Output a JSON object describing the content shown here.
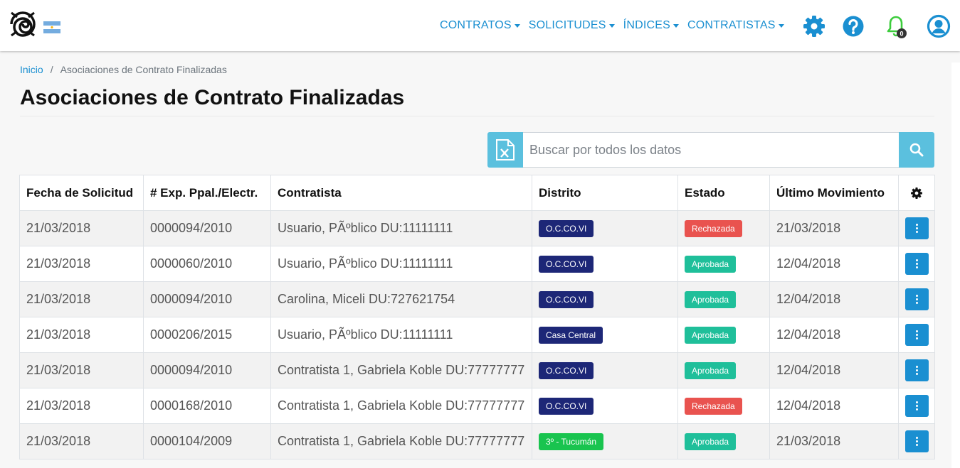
{
  "nav": {
    "items": [
      {
        "label": "CONTRATOS"
      },
      {
        "label": "SOLICITUDES"
      },
      {
        "label": "ÍNDICES"
      },
      {
        "label": "CONTRATISTAS"
      }
    ],
    "notification_count": "0"
  },
  "breadcrumb": {
    "home": "Inicio",
    "separator": "/",
    "current": "Asociaciones de Contrato Finalizadas"
  },
  "page": {
    "title": "Asociaciones de Contrato Finalizadas"
  },
  "search": {
    "placeholder": "Buscar por todos los datos",
    "value": ""
  },
  "table": {
    "headers": [
      "Fecha de Solicitud",
      "# Exp. Ppal./Electr.",
      "Contratista",
      "Distrito",
      "Estado",
      "Último Movimiento"
    ],
    "rows": [
      {
        "fecha": "21/03/2018",
        "exp": "0000094/2010",
        "contratista": "Usuario, PÃºblico DU:11111111",
        "distrito": "O.C.CO.VI",
        "distrito_color": "#1d2777",
        "estado": "Rechazada",
        "estado_color": "#e9534f",
        "ultimo": "21/03/2018"
      },
      {
        "fecha": "21/03/2018",
        "exp": "0000060/2010",
        "contratista": "Usuario, PÃºblico DU:11111111",
        "distrito": "O.C.CO.VI",
        "distrito_color": "#1d2777",
        "estado": "Aprobada",
        "estado_color": "#1fbf9a",
        "ultimo": "12/04/2018"
      },
      {
        "fecha": "21/03/2018",
        "exp": "0000094/2010",
        "contratista": "Carolina, Miceli DU:727621754",
        "distrito": "O.C.CO.VI",
        "distrito_color": "#1d2777",
        "estado": "Aprobada",
        "estado_color": "#1fbf9a",
        "ultimo": "12/04/2018"
      },
      {
        "fecha": "21/03/2018",
        "exp": "0000206/2015",
        "contratista": "Usuario, PÃºblico DU:11111111",
        "distrito": "Casa Central",
        "distrito_color": "#1d2777",
        "estado": "Aprobada",
        "estado_color": "#1fbf9a",
        "ultimo": "12/04/2018"
      },
      {
        "fecha": "21/03/2018",
        "exp": "0000094/2010",
        "contratista": "Contratista 1, Gabriela Koble DU:77777777",
        "distrito": "O.C.CO.VI",
        "distrito_color": "#1d2777",
        "estado": "Aprobada",
        "estado_color": "#1fbf9a",
        "ultimo": "12/04/2018"
      },
      {
        "fecha": "21/03/2018",
        "exp": "0000168/2010",
        "contratista": "Contratista 1, Gabriela Koble DU:77777777",
        "distrito": "O.C.CO.VI",
        "distrito_color": "#1d2777",
        "estado": "Rechazada",
        "estado_color": "#e9534f",
        "ultimo": "12/04/2018"
      },
      {
        "fecha": "21/03/2018",
        "exp": "0000104/2009",
        "contratista": "Contratista 1, Gabriela Koble DU:77777777",
        "distrito": "3º - Tucumán",
        "distrito_color": "#19c44f",
        "estado": "Aprobada",
        "estado_color": "#1fbf9a",
        "ultimo": "21/03/2018"
      }
    ]
  },
  "colors": {
    "accent": "#1a8fd1",
    "info": "#5bc0de",
    "bell": "#3ccc3c"
  },
  "icons": {
    "logo": "spiral-logo-icon",
    "flag": "argentina-flag-icon",
    "settings": "gear-icon",
    "help": "question-icon",
    "notifications": "bell-icon",
    "user": "user-icon",
    "export": "excel-icon",
    "search": "search-icon",
    "table_settings": "gear-icon",
    "row_action": "vertical-dots-icon"
  }
}
